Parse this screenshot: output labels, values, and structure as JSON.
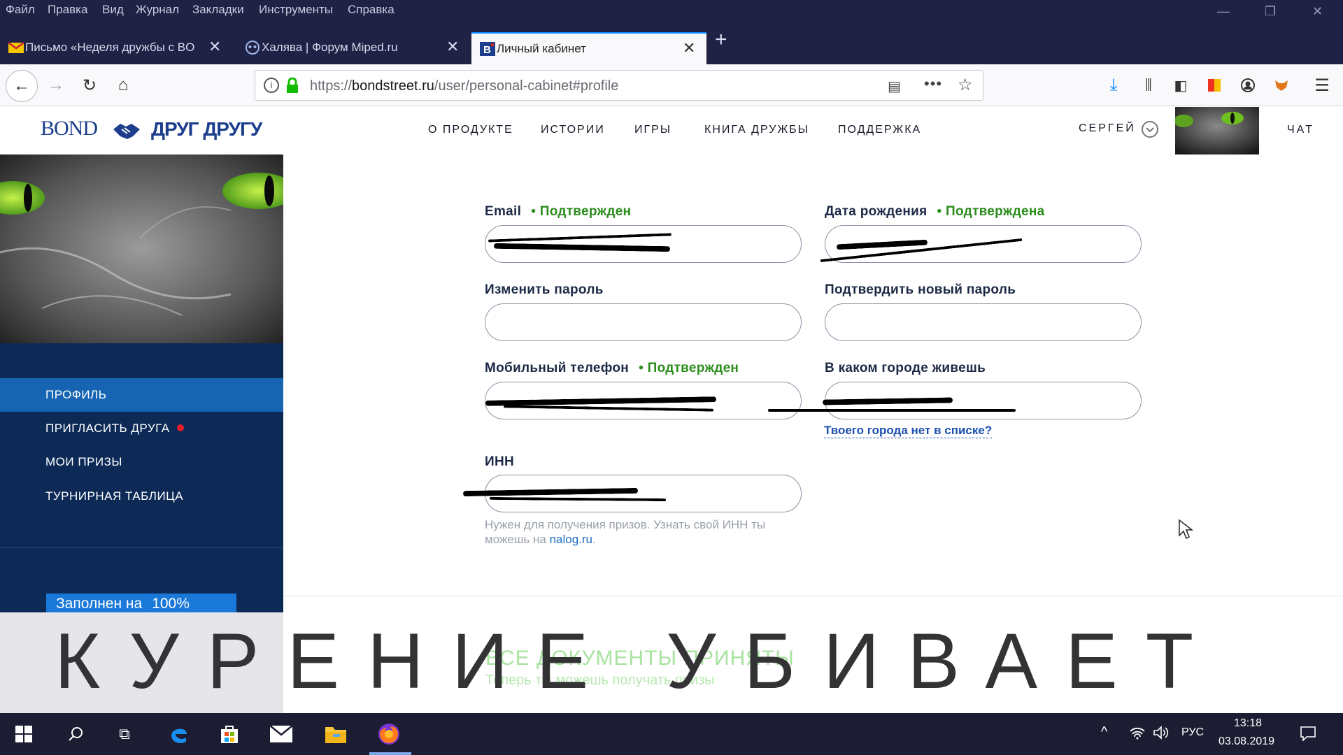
{
  "browser": {
    "menu": [
      "Файл",
      "Правка",
      "Вид",
      "Журнал",
      "Закладки",
      "Инструменты",
      "Справка"
    ],
    "tabs": [
      {
        "title": "Письмо «Неделя дружбы с BO",
        "active": false
      },
      {
        "title": "Халява | Форум Miped.ru",
        "active": false
      },
      {
        "title": "Личный кабинет",
        "active": true
      }
    ],
    "url_prefix": "https://",
    "url_host": "bondstreet.ru",
    "url_path": "/user/personal-cabinet#profile"
  },
  "site": {
    "logo_main": "BOND",
    "logo_sub": "ДРУГ ДРУГУ",
    "nav": [
      "О ПРОДУКТЕ",
      "ИСТОРИИ",
      "ИГРЫ",
      "КНИГА ДРУЖБЫ",
      "ПОДДЕРЖКА"
    ],
    "user_name": "СЕРГЕЙ",
    "chat": "ЧАТ"
  },
  "sidebar": {
    "items": [
      {
        "label": "ПРОФИЛЬ",
        "active": true,
        "badge": false
      },
      {
        "label": "ПРИГЛАСИТЬ ДРУГА",
        "active": false,
        "badge": true
      },
      {
        "label": "МОИ ПРИЗЫ",
        "active": false,
        "badge": false
      },
      {
        "label": "ТУРНИРНАЯ ТАБЛИЦА",
        "active": false,
        "badge": false
      }
    ],
    "progress_label": "Заполнен на",
    "progress_value": "100%"
  },
  "form": {
    "email_label": "Email",
    "email_status": "Подтвержден",
    "birth_label": "Дата рождения",
    "birth_status": "Подтверждена",
    "pass_label": "Изменить пароль",
    "pass_confirm_label": "Подтвердить новый пароль",
    "phone_label": "Мобильный телефон",
    "phone_status": "Подтвержден",
    "city_label": "В каком городе живешь",
    "city_missing_link": "Твоего города нет в списке?",
    "inn_label": "ИНН",
    "inn_hint": "Нужен для получения призов. Узнать свой ИНН ты можешь на",
    "inn_hint_link": "nalog.ru"
  },
  "docs": {
    "title": "ВСЕ ДОКУМЕНТЫ ПРИНЯТЫ",
    "subtitle": "Теперь ты можешь получать призы"
  },
  "warning": "КУРЕНИЕ УБИВАЕТ",
  "taskbar": {
    "lang": "РУС",
    "time": "13:18",
    "date": "03.08.2019"
  }
}
